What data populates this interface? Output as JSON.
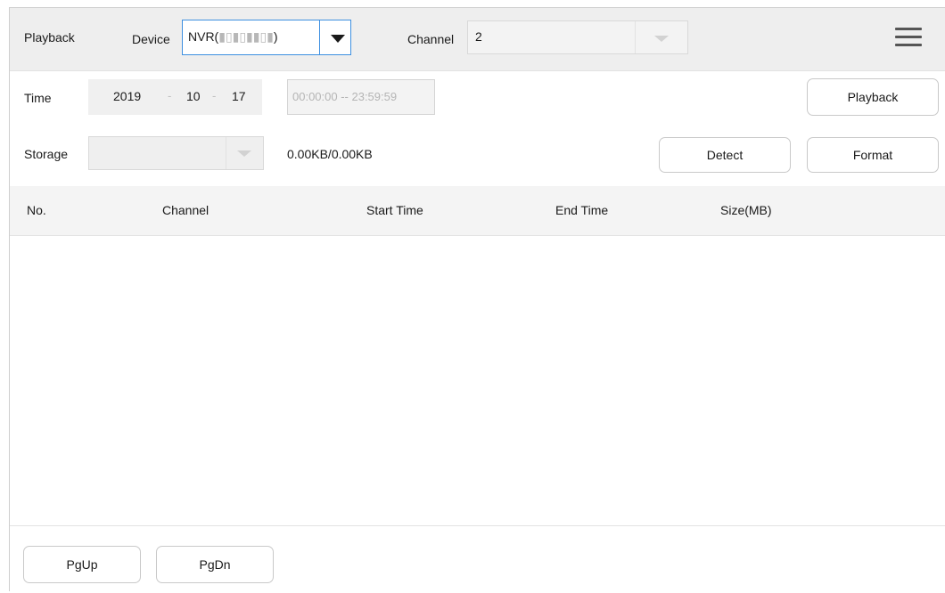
{
  "header": {
    "title": "Playback",
    "device_label": "Device",
    "device_value_prefix": "NVR(",
    "device_value_masked": "▮▯▮▯▮▮▯▮",
    "device_value_suffix": ")",
    "channel_label": "Channel",
    "channel_value": "2",
    "menu_icon": "hamburger-menu-icon"
  },
  "time_row": {
    "label": "Time",
    "year": "2019",
    "month": "10",
    "day": "17",
    "separator": "-",
    "time_range": "00:00:00 -- 23:59:59",
    "playback_button": "Playback"
  },
  "storage_row": {
    "label": "Storage",
    "selected": "",
    "capacity": "0.00KB/0.00KB",
    "detect_button": "Detect",
    "format_button": "Format"
  },
  "table": {
    "columns": [
      "No.",
      "Channel",
      "Start Time",
      "End Time",
      "Size(MB)"
    ],
    "rows": []
  },
  "footer": {
    "pgup_button": "PgUp",
    "pgdn_button": "PgDn"
  },
  "colors": {
    "accent_border": "#3d8fe0",
    "header_bg": "#eeeeee",
    "disabled_text": "#b5b5b5"
  }
}
